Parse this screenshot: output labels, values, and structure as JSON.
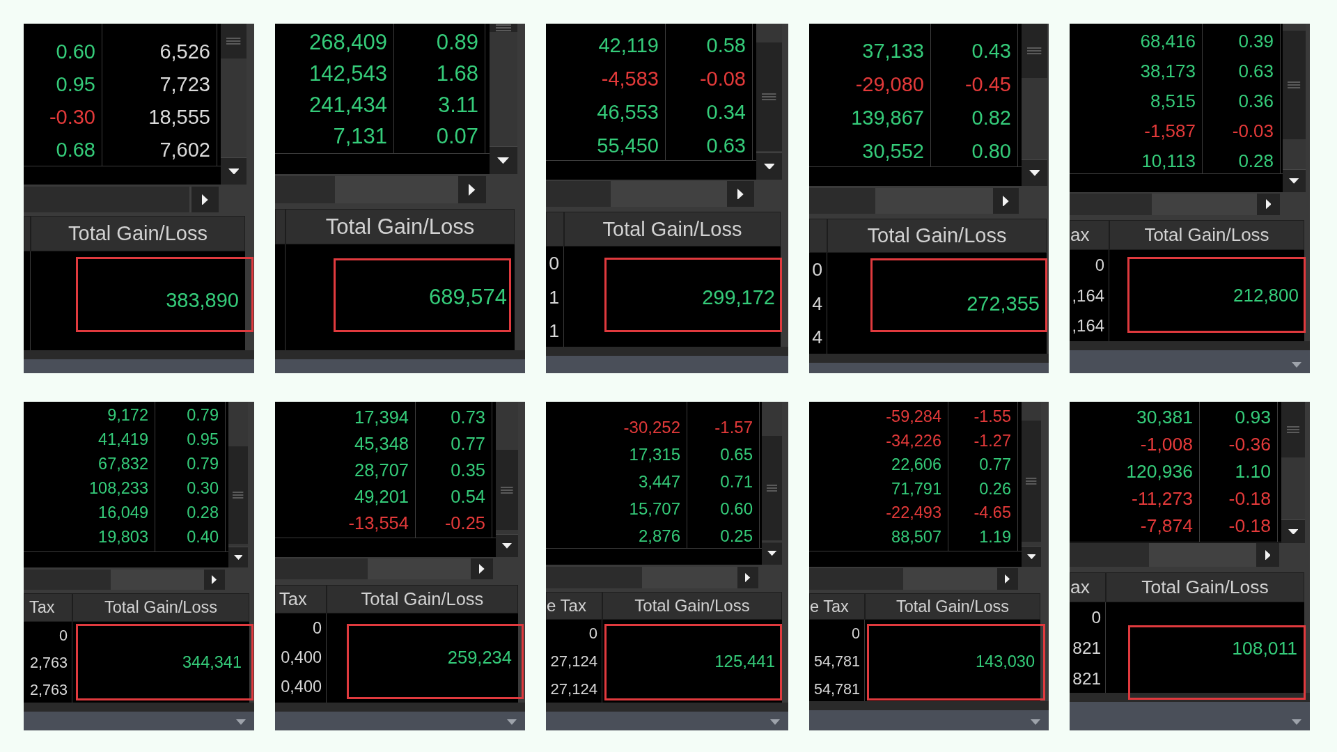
{
  "panels": [
    {
      "grid": {
        "rows": [
          {
            "cells": [
              {
                "text": "0.60",
                "color": "#35cc7a"
              },
              {
                "text": "6,526",
                "color": "#dadada"
              }
            ]
          },
          {
            "cells": [
              {
                "text": "0.95",
                "color": "#35cc7a"
              },
              {
                "text": "7,723",
                "color": "#dadada"
              }
            ]
          },
          {
            "cells": [
              {
                "text": "-0.30",
                "color": "#e43a3a"
              },
              {
                "text": "18,555",
                "color": "#dadada"
              }
            ]
          },
          {
            "cells": [
              {
                "text": "0.68",
                "color": "#35cc7a"
              },
              {
                "text": "7,602",
                "color": "#dadada"
              }
            ]
          }
        ]
      },
      "summary": {
        "total": {
          "header": "Total Gain/Loss",
          "value": "383,890",
          "color": "#35cc7a",
          "highlighted": true
        }
      }
    },
    {
      "grid": {
        "rows": [
          {
            "cells": [
              {
                "text": "268,409",
                "color": "#35cc7a"
              },
              {
                "text": "0.89",
                "color": "#35cc7a"
              }
            ]
          },
          {
            "cells": [
              {
                "text": "142,543",
                "color": "#35cc7a"
              },
              {
                "text": "1.68",
                "color": "#35cc7a"
              }
            ]
          },
          {
            "cells": [
              {
                "text": "241,434",
                "color": "#35cc7a"
              },
              {
                "text": "3.11",
                "color": "#35cc7a"
              }
            ]
          },
          {
            "cells": [
              {
                "text": "7,131",
                "color": "#35cc7a"
              },
              {
                "text": "0.07",
                "color": "#35cc7a"
              }
            ]
          }
        ]
      },
      "summary": {
        "total": {
          "header": "Total Gain/Loss",
          "value": "689,574",
          "color": "#35cc7a",
          "highlighted": true
        }
      }
    },
    {
      "grid": {
        "rows": [
          {
            "cells": [
              {
                "text": "42,119",
                "color": "#35cc7a"
              },
              {
                "text": "0.58",
                "color": "#35cc7a"
              }
            ]
          },
          {
            "cells": [
              {
                "text": "-4,583",
                "color": "#e43a3a"
              },
              {
                "text": "-0.08",
                "color": "#e43a3a"
              }
            ]
          },
          {
            "cells": [
              {
                "text": "46,553",
                "color": "#35cc7a"
              },
              {
                "text": "0.34",
                "color": "#35cc7a"
              }
            ]
          },
          {
            "cells": [
              {
                "text": "55,450",
                "color": "#35cc7a"
              },
              {
                "text": "0.63",
                "color": "#35cc7a"
              }
            ]
          }
        ]
      },
      "summary": {
        "column_1": {
          "values": [
            "0",
            "1",
            "1"
          ]
        },
        "total": {
          "header": "Total Gain/Loss",
          "value": "299,172",
          "color": "#35cc7a",
          "highlighted": true
        }
      }
    },
    {
      "grid": {
        "rows": [
          {
            "cells": [
              {
                "text": "37,133",
                "color": "#35cc7a"
              },
              {
                "text": "0.43",
                "color": "#35cc7a"
              }
            ]
          },
          {
            "cells": [
              {
                "text": "-29,080",
                "color": "#e43a3a"
              },
              {
                "text": "-0.45",
                "color": "#e43a3a"
              }
            ]
          },
          {
            "cells": [
              {
                "text": "139,867",
                "color": "#35cc7a"
              },
              {
                "text": "0.82",
                "color": "#35cc7a"
              }
            ]
          },
          {
            "cells": [
              {
                "text": "30,552",
                "color": "#35cc7a"
              },
              {
                "text": "0.80",
                "color": "#35cc7a"
              }
            ]
          }
        ]
      },
      "summary": {
        "column_1": {
          "values": [
            "0",
            "4",
            "4"
          ]
        },
        "total": {
          "header": "Total Gain/Loss",
          "value": "272,355",
          "color": "#35cc7a",
          "highlighted": true
        }
      }
    },
    {
      "grid": {
        "rows": [
          {
            "cells": [
              {
                "text": "68,416",
                "color": "#35cc7a"
              },
              {
                "text": "0.39",
                "color": "#35cc7a"
              }
            ]
          },
          {
            "cells": [
              {
                "text": "38,173",
                "color": "#35cc7a"
              },
              {
                "text": "0.63",
                "color": "#35cc7a"
              }
            ]
          },
          {
            "cells": [
              {
                "text": "8,515",
                "color": "#35cc7a"
              },
              {
                "text": "0.36",
                "color": "#35cc7a"
              }
            ]
          },
          {
            "cells": [
              {
                "text": "-1,587",
                "color": "#e43a3a"
              },
              {
                "text": "-0.03",
                "color": "#e43a3a"
              }
            ]
          },
          {
            "cells": [
              {
                "text": "10,113",
                "color": "#35cc7a"
              },
              {
                "text": "0.28",
                "color": "#35cc7a"
              }
            ]
          }
        ]
      },
      "summary": {
        "column_1": {
          "header": "ax",
          "values": [
            "0",
            ",164",
            ",164"
          ]
        },
        "total": {
          "header": "Total Gain/Loss",
          "value": "212,800",
          "color": "#35cc7a",
          "highlighted": true
        }
      }
    },
    {
      "grid": {
        "rows": [
          {
            "cells": [
              {
                "text": "9,172",
                "color": "#35cc7a"
              },
              {
                "text": "0.79",
                "color": "#35cc7a"
              }
            ]
          },
          {
            "cells": [
              {
                "text": "41,419",
                "color": "#35cc7a"
              },
              {
                "text": "0.95",
                "color": "#35cc7a"
              }
            ]
          },
          {
            "cells": [
              {
                "text": "67,832",
                "color": "#35cc7a"
              },
              {
                "text": "0.79",
                "color": "#35cc7a"
              }
            ]
          },
          {
            "cells": [
              {
                "text": "108,233",
                "color": "#35cc7a"
              },
              {
                "text": "0.30",
                "color": "#35cc7a"
              }
            ]
          },
          {
            "cells": [
              {
                "text": "16,049",
                "color": "#35cc7a"
              },
              {
                "text": "0.28",
                "color": "#35cc7a"
              }
            ]
          },
          {
            "cells": [
              {
                "text": "19,803",
                "color": "#35cc7a"
              },
              {
                "text": "0.40",
                "color": "#35cc7a"
              }
            ]
          }
        ]
      },
      "summary": {
        "column_1": {
          "header": "Tax",
          "values": [
            "0",
            "2,763",
            "2,763"
          ]
        },
        "total": {
          "header": "Total Gain/Loss",
          "value": "344,341",
          "color": "#35cc7a",
          "highlighted": true
        }
      }
    },
    {
      "grid": {
        "rows": [
          {
            "cells": [
              {
                "text": "17,394",
                "color": "#35cc7a"
              },
              {
                "text": "0.73",
                "color": "#35cc7a"
              }
            ]
          },
          {
            "cells": [
              {
                "text": "45,348",
                "color": "#35cc7a"
              },
              {
                "text": "0.77",
                "color": "#35cc7a"
              }
            ]
          },
          {
            "cells": [
              {
                "text": "28,707",
                "color": "#35cc7a"
              },
              {
                "text": "0.35",
                "color": "#35cc7a"
              }
            ]
          },
          {
            "cells": [
              {
                "text": "49,201",
                "color": "#35cc7a"
              },
              {
                "text": "0.54",
                "color": "#35cc7a"
              }
            ]
          },
          {
            "cells": [
              {
                "text": "-13,554",
                "color": "#e43a3a"
              },
              {
                "text": "-0.25",
                "color": "#e43a3a"
              }
            ]
          }
        ]
      },
      "summary": {
        "column_1": {
          "header": "Tax",
          "values": [
            "0",
            "0,400",
            "0,400"
          ]
        },
        "total": {
          "header": "Total Gain/Loss",
          "value": "259,234",
          "color": "#35cc7a",
          "highlighted": true
        }
      }
    },
    {
      "grid": {
        "rows": [
          {
            "cells": [
              {
                "text": "-30,252",
                "color": "#e43a3a"
              },
              {
                "text": "-1.57",
                "color": "#e43a3a"
              }
            ]
          },
          {
            "cells": [
              {
                "text": "17,315",
                "color": "#35cc7a"
              },
              {
                "text": "0.65",
                "color": "#35cc7a"
              }
            ]
          },
          {
            "cells": [
              {
                "text": "3,447",
                "color": "#35cc7a"
              },
              {
                "text": "0.71",
                "color": "#35cc7a"
              }
            ]
          },
          {
            "cells": [
              {
                "text": "15,707",
                "color": "#35cc7a"
              },
              {
                "text": "0.60",
                "color": "#35cc7a"
              }
            ]
          },
          {
            "cells": [
              {
                "text": "2,876",
                "color": "#35cc7a"
              },
              {
                "text": "0.25",
                "color": "#35cc7a"
              }
            ]
          }
        ]
      },
      "summary": {
        "column_1": {
          "header": "e Tax",
          "values": [
            "0",
            "27,124",
            "27,124"
          ]
        },
        "total": {
          "header": "Total Gain/Loss",
          "value": "125,441",
          "color": "#35cc7a",
          "highlighted": true
        }
      }
    },
    {
      "grid": {
        "rows": [
          {
            "cells": [
              {
                "text": "-59,284",
                "color": "#e43a3a"
              },
              {
                "text": "-1.55",
                "color": "#e43a3a"
              }
            ]
          },
          {
            "cells": [
              {
                "text": "-34,226",
                "color": "#e43a3a"
              },
              {
                "text": "-1.27",
                "color": "#e43a3a"
              }
            ]
          },
          {
            "cells": [
              {
                "text": "22,606",
                "color": "#35cc7a"
              },
              {
                "text": "0.77",
                "color": "#35cc7a"
              }
            ]
          },
          {
            "cells": [
              {
                "text": "71,791",
                "color": "#35cc7a"
              },
              {
                "text": "0.26",
                "color": "#35cc7a"
              }
            ]
          },
          {
            "cells": [
              {
                "text": "-22,493",
                "color": "#e43a3a"
              },
              {
                "text": "-4.65",
                "color": "#e43a3a"
              }
            ]
          },
          {
            "cells": [
              {
                "text": "88,507",
                "color": "#35cc7a"
              },
              {
                "text": "1.19",
                "color": "#35cc7a"
              }
            ]
          }
        ]
      },
      "summary": {
        "column_1": {
          "header": "e Tax",
          "values": [
            "0",
            "54,781",
            "54,781"
          ]
        },
        "total": {
          "header": "Total Gain/Loss",
          "value": "143,030",
          "color": "#35cc7a",
          "highlighted": true
        }
      }
    },
    {
      "grid": {
        "rows": [
          {
            "cells": [
              {
                "text": "30,381",
                "color": "#35cc7a"
              },
              {
                "text": "0.93",
                "color": "#35cc7a"
              }
            ]
          },
          {
            "cells": [
              {
                "text": "-1,008",
                "color": "#e43a3a"
              },
              {
                "text": "-0.36",
                "color": "#e43a3a"
              }
            ]
          },
          {
            "cells": [
              {
                "text": "120,936",
                "color": "#35cc7a"
              },
              {
                "text": "1.10",
                "color": "#35cc7a"
              }
            ]
          },
          {
            "cells": [
              {
                "text": "-11,273",
                "color": "#e43a3a"
              },
              {
                "text": "-0.18",
                "color": "#e43a3a"
              }
            ]
          },
          {
            "cells": [
              {
                "text": "-7,874",
                "color": "#e43a3a"
              },
              {
                "text": "-0.18",
                "color": "#e43a3a"
              }
            ]
          }
        ]
      },
      "summary": {
        "column_1": {
          "header": "ax",
          "values": [
            "0",
            "821",
            "821"
          ]
        },
        "total": {
          "header": "Total Gain/Loss",
          "value": "108,011",
          "color": "#35cc7a",
          "highlighted": true
        }
      }
    }
  ]
}
